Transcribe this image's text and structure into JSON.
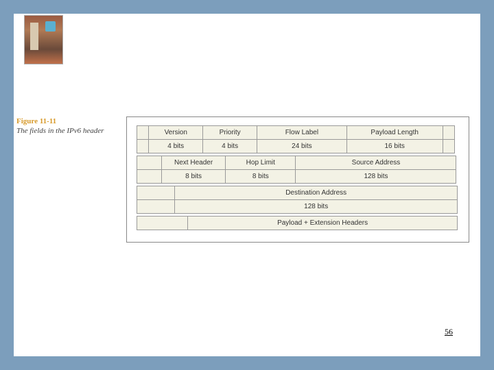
{
  "figure": {
    "number": "Figure 11-11",
    "caption": "The fields in the IPv6 header"
  },
  "header_rows": [
    {
      "lead_pct": 4,
      "cells": [
        {
          "label": "Version",
          "size": "4 bits",
          "pct": 17
        },
        {
          "label": "Priority",
          "size": "4 bits",
          "pct": 17
        },
        {
          "label": "Flow Label",
          "size": "24 bits",
          "pct": 28
        },
        {
          "label": "Payload Length",
          "size": "16 bits",
          "pct": 30
        }
      ],
      "tail_pct": 4
    },
    {
      "lead_pct": 8,
      "cells": [
        {
          "label": "Next Header",
          "size": "8 bits",
          "pct": 20
        },
        {
          "label": "Hop Limit",
          "size": "8 bits",
          "pct": 22
        },
        {
          "label": "Source Address",
          "size": "128 bits",
          "pct": 50
        }
      ],
      "tail_pct": 0
    },
    {
      "lead_pct": 12,
      "cells": [
        {
          "label": "Destination Address",
          "size": "128 bits",
          "pct": 88
        }
      ],
      "tail_pct": 0
    },
    {
      "lead_pct": 16,
      "cells": [
        {
          "label": "Payload + Extension Headers",
          "size": "",
          "pct": 84
        }
      ],
      "tail_pct": 0
    }
  ],
  "page_number": "56"
}
